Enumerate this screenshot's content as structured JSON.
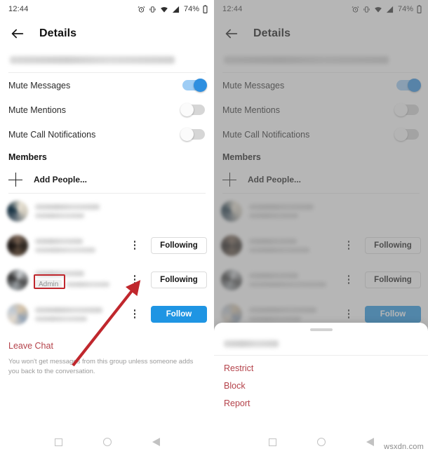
{
  "status_bar": {
    "time": "12:44",
    "battery_percent": "74%",
    "icons": [
      "alarm-icon",
      "vibrate-icon",
      "wifi-icon",
      "signal-icon",
      "battery-icon"
    ]
  },
  "app_bar": {
    "back": "back-arrow-icon",
    "title": "Details"
  },
  "group": {
    "name_redacted": "group name hidden"
  },
  "settings": {
    "rows": [
      {
        "label": "Mute Messages",
        "state": "on"
      },
      {
        "label": "Mute Mentions",
        "state": "off"
      },
      {
        "label": "Mute Call Notifications",
        "state": "off"
      }
    ]
  },
  "members_section": {
    "title": "Members",
    "add_people_label": "Add People...",
    "rows": [
      {
        "avatar": "av1",
        "name_redacted": "member name hidden",
        "sub_redacted": "",
        "badge": "",
        "button": ""
      },
      {
        "avatar": "av2",
        "name_redacted": "member name hidden",
        "sub_redacted": "",
        "badge": "",
        "button": "Following"
      },
      {
        "avatar": "av3",
        "name_redacted": "member name hidden",
        "sub_redacted": "member handle hidden",
        "badge": "Admin",
        "button": "Following"
      },
      {
        "avatar": "av4",
        "name_redacted": "member name hidden",
        "sub_redacted": "member handle hidden",
        "badge": "",
        "button": "Follow"
      }
    ]
  },
  "leave": {
    "link": "Leave Chat",
    "description": "You won't get messages from this group unless someone adds you back to the conversation."
  },
  "action_sheet": {
    "user_redacted": "username hidden",
    "items": [
      "Restrict",
      "Block",
      "Report"
    ]
  },
  "nav_bar": {
    "items": [
      "recents-square-icon",
      "home-circle-icon",
      "back-triangle-icon"
    ]
  },
  "watermark": {
    "text": "wsxdn.com"
  },
  "colors": {
    "accent_blue": "#1f95e3",
    "toggle_on": "#2e8fe0",
    "danger_red": "#b4424a",
    "annotation_red": "#c0272d"
  }
}
